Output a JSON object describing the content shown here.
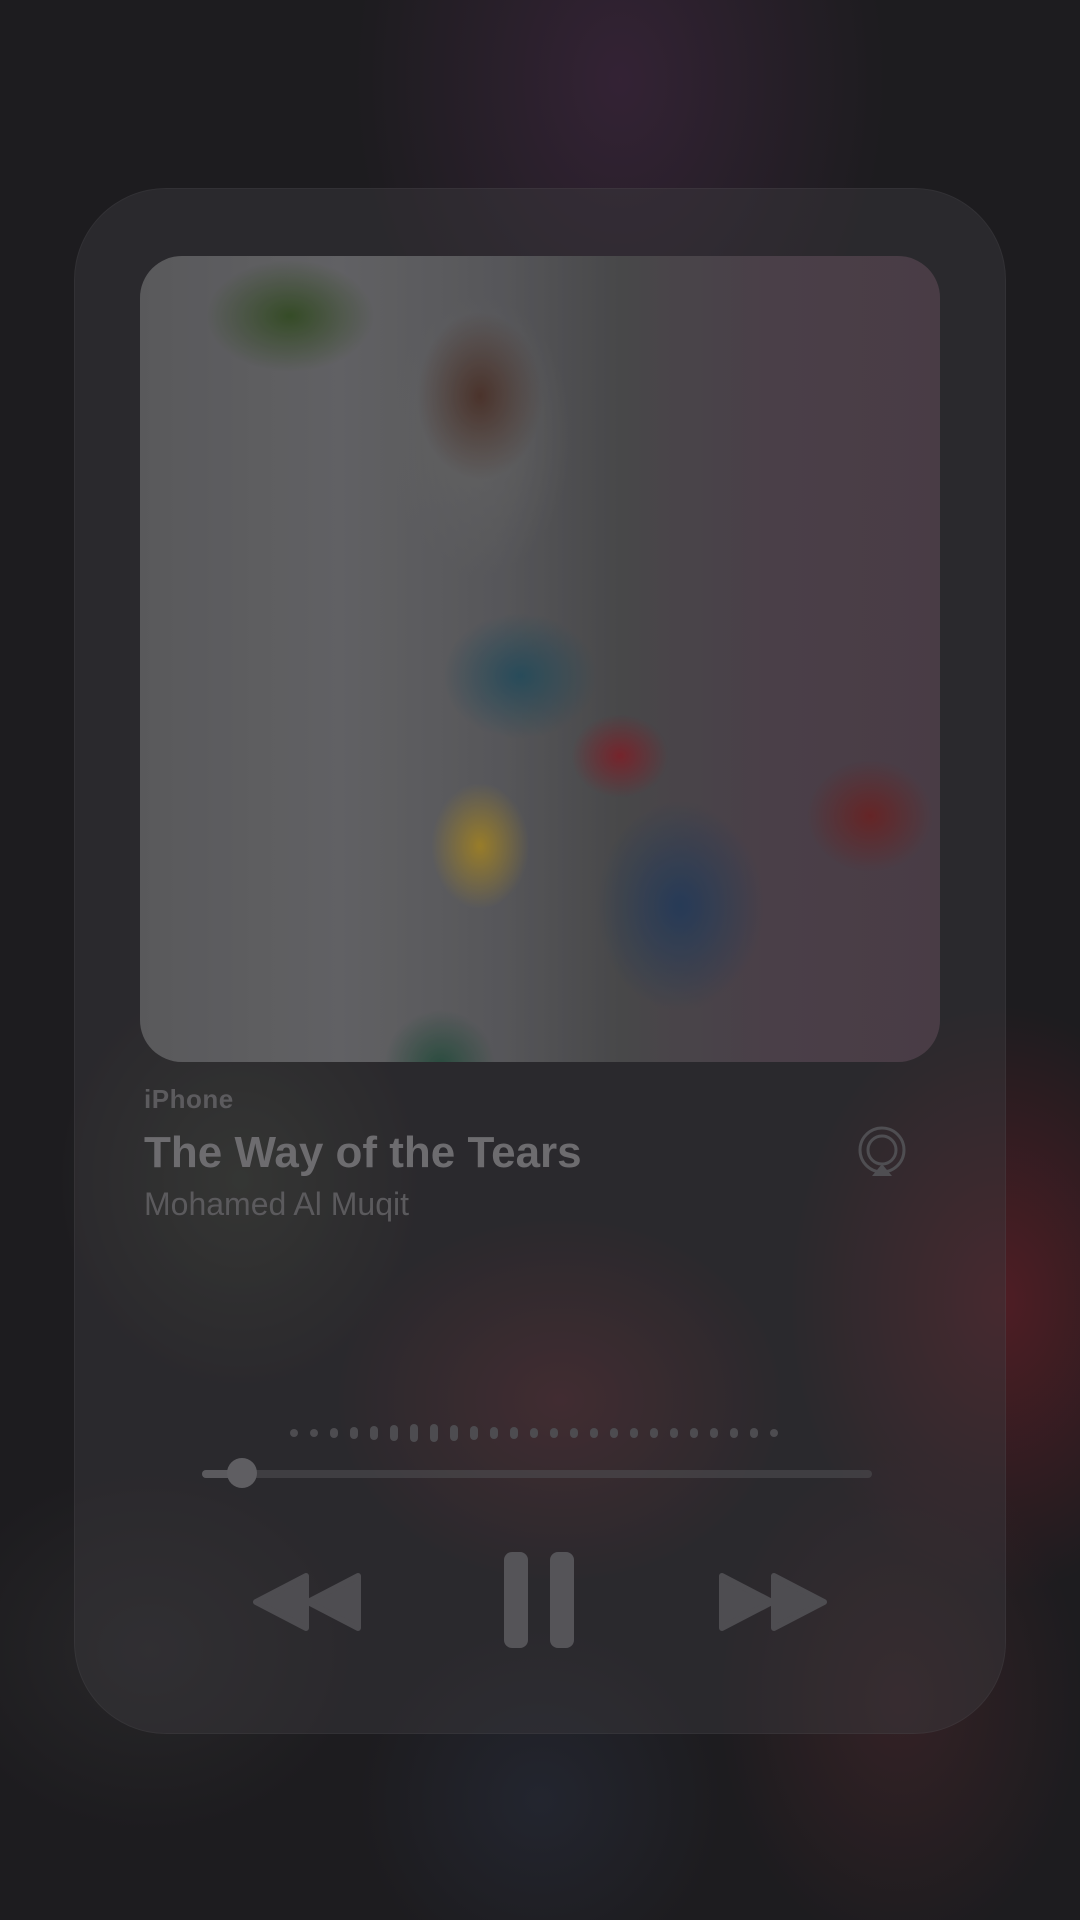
{
  "now_playing": {
    "source": "iPhone",
    "title": "The Way of the Tears",
    "artist": "Mohamed Al Muqit",
    "progress": 0.06
  },
  "icons": {
    "airplay": "airplay-icon",
    "rewind": "rewind-icon",
    "pause": "pause-icon",
    "forward": "fast-forward-icon"
  },
  "colors": {
    "controls": "#555458",
    "text_primary": "#6d6c6f",
    "text_secondary": "#5b5a5d"
  }
}
